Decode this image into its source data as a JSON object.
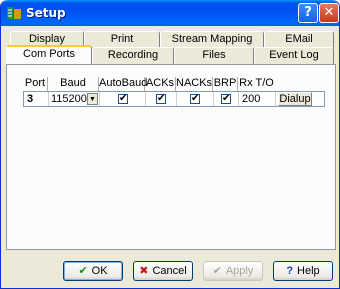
{
  "window": {
    "title": "Setup",
    "help_glyph": "?",
    "close_glyph": "✕"
  },
  "tabs": {
    "row_back": [
      "Display",
      "Print",
      "Stream Mapping",
      "EMail"
    ],
    "row_front": [
      "Com Ports",
      "Recording",
      "Files",
      "Event Log"
    ],
    "active": "Com Ports"
  },
  "grid": {
    "headers": [
      "Port",
      "Baud Rate",
      "AutoBaud",
      "ACKs",
      "NACKs",
      "BRP",
      "Rx T/O"
    ],
    "rows": [
      {
        "port": "3",
        "baud_rate": "115200",
        "autobaud": true,
        "acks": true,
        "nacks": true,
        "brp": true,
        "rx_timeout": "200",
        "action_label": "Dialup"
      }
    ],
    "check_glyph": "✔",
    "dropdown_glyph": "▼"
  },
  "buttons": {
    "ok": {
      "label": "OK",
      "icon": "check-icon",
      "glyph": "✔",
      "color": "#1a8f1a"
    },
    "cancel": {
      "label": "Cancel",
      "icon": "x-icon",
      "glyph": "✖",
      "color": "#c41a1a"
    },
    "apply": {
      "label": "Apply",
      "icon": "check-icon",
      "glyph": "✔",
      "disabled": true
    },
    "help": {
      "label": "Help",
      "icon": "question-icon",
      "glyph": "?",
      "color": "#1a3fc4"
    }
  },
  "colors": {
    "titlebar": "#0053ee",
    "active_tab_highlight": "#ffc83c",
    "dialog_bg": "#ece9d8"
  }
}
